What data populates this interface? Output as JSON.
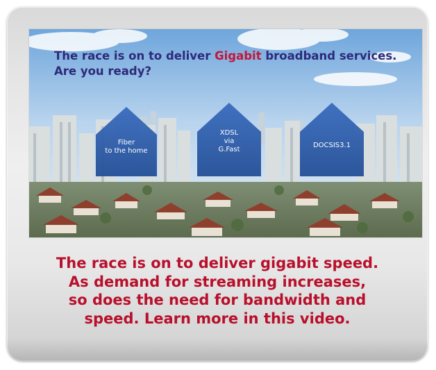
{
  "video": {
    "headline_pre": "The race is on to deliver ",
    "headline_accent": "Gigabit",
    "headline_post": " broadband services.",
    "headline_line2": "Are you ready?",
    "houses": [
      {
        "line1": "Fiber",
        "line2": "to the home",
        "line3": ""
      },
      {
        "line1": "XDSL",
        "line2": "via",
        "line3": "G.Fast"
      },
      {
        "line1": "DOCSIS3.1",
        "line2": "",
        "line3": ""
      }
    ]
  },
  "caption": {
    "line1": "The race is on to deliver gigabit speed.",
    "line2": "As demand for streaming increases,",
    "line3": "so does the need for bandwidth and",
    "line4": "speed. Learn more in this video."
  },
  "colors": {
    "caption": "#b8102c",
    "headline": "#2d2a7a",
    "headline_accent": "#c4163a",
    "house": "#2f5fae"
  }
}
